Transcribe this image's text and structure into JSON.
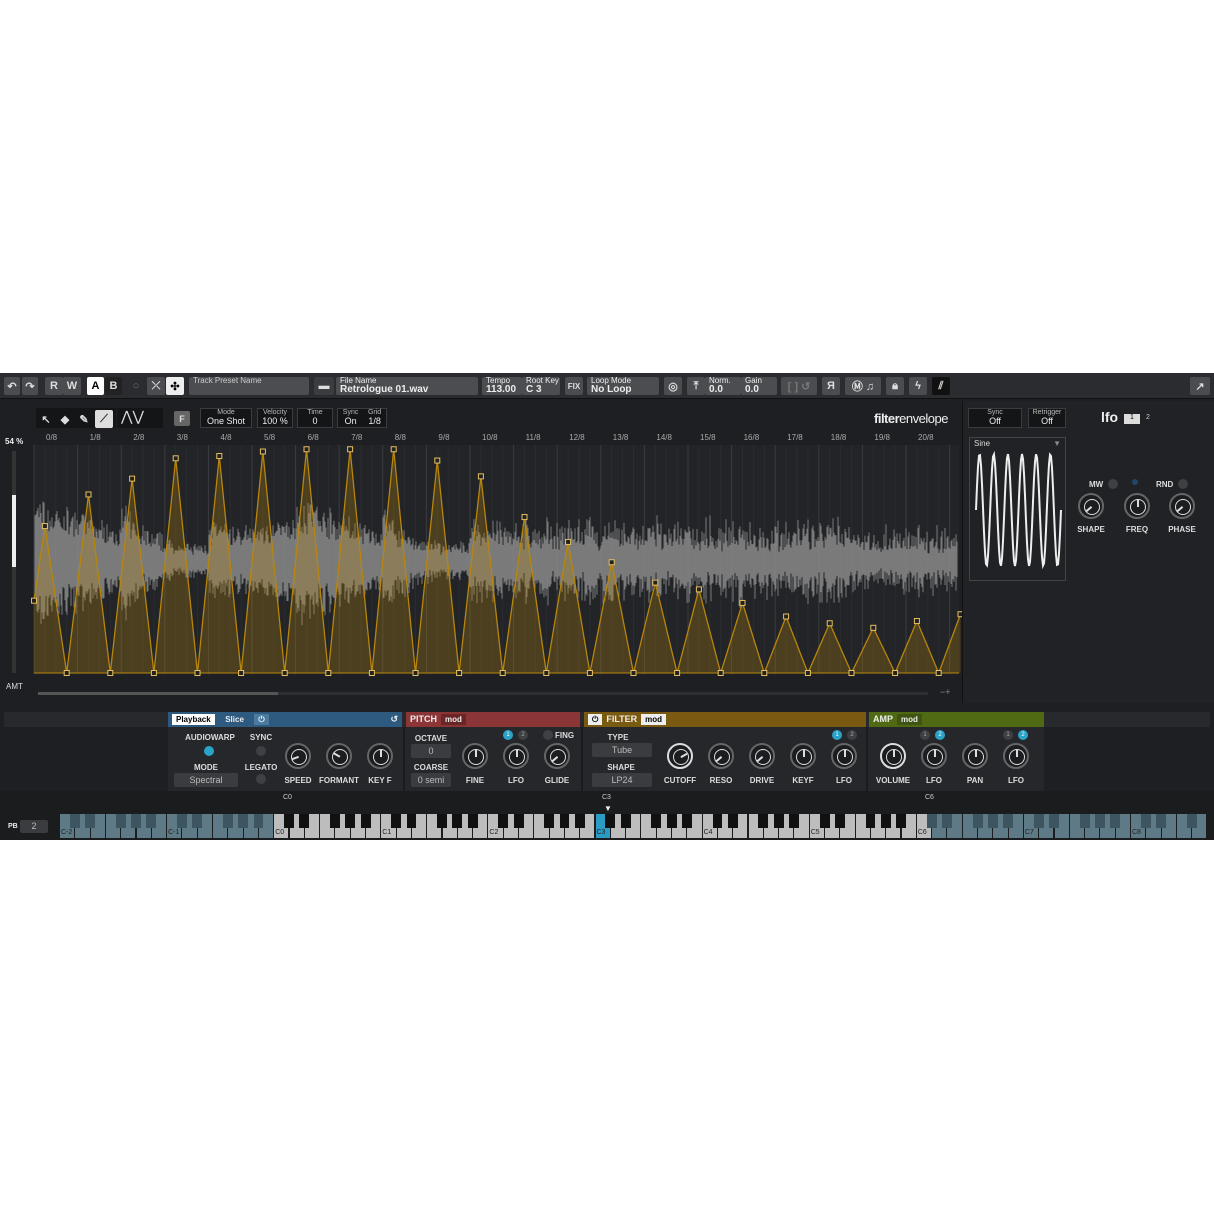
{
  "toolbar": {
    "r": "R",
    "w": "W",
    "a": "A",
    "b": "B",
    "track_preset_label": "Track Preset Name",
    "file_name_label": "File Name",
    "file_name": "Retrologue 01.wav",
    "tempo_label": "Tempo",
    "tempo": "113.00",
    "root_key_label": "Root Key",
    "root_key": "C 3",
    "fix": "FIX",
    "loop_mode_label": "Loop Mode",
    "loop_mode": "No Loop",
    "norm_label": "Norm.",
    "norm": "0.0",
    "gain_label": "Gain",
    "gain": "0.0",
    "reverse": "Я"
  },
  "editor": {
    "mode_label": "Mode",
    "mode": "One Shot",
    "velocity_label": "Velocity",
    "velocity": "100 %",
    "time_label": "Time",
    "time": "0",
    "sync_label": "Sync",
    "sync": "On",
    "grid_label": "Grid",
    "grid": "1/8",
    "f_button": "F",
    "title_bold": "filter",
    "title_light": "envelope",
    "amount": "54 %",
    "amt_label": "AMT",
    "zoom_ctrl": "−+",
    "time_labels": [
      "0/8",
      "1/8",
      "2/8",
      "3/8",
      "4/8",
      "5/8",
      "6/8",
      "7/8",
      "8/8",
      "9/8",
      "10/8",
      "11/8",
      "12/8",
      "13/8",
      "14/8",
      "15/8",
      "16/8",
      "17/8",
      "18/8",
      "19/8",
      "20/8"
    ],
    "envelope_start_level": 0.32,
    "envelope_peaks": [
      0.65,
      0.79,
      0.86,
      0.95,
      0.96,
      0.98,
      0.99,
      0.99,
      0.99,
      0.94,
      0.87,
      0.69,
      0.58,
      0.49,
      0.4,
      0.37,
      0.31,
      0.25,
      0.22,
      0.2,
      0.23,
      0.26
    ],
    "amount_fraction": 0.54,
    "color_envelope": "#b8860b"
  },
  "lfo": {
    "sync_label": "Sync",
    "sync": "Off",
    "retrigger_label": "Retrigger",
    "retrigger": "Off",
    "title": "lfo",
    "tab1": "1",
    "tab2": "2",
    "waveform": "Sine",
    "mw": "MW",
    "rnd": "RND",
    "shape": "SHAPE",
    "freq": "FREQ",
    "phase": "PHASE"
  },
  "playback": {
    "tab_playback": "Playback",
    "tab_slice": "Slice",
    "audiowarp": "AUDIOWARP",
    "sync": "SYNC",
    "mode": "MODE",
    "mode_value": "Spectral",
    "legato": "LEGATO",
    "speed": "SPEED",
    "formant": "FORMANT",
    "keyf": "KEY F",
    "color": "#2f5a80"
  },
  "pitch": {
    "title": "PITCH",
    "mod": "mod",
    "octave": "OCTAVE",
    "octave_value": "0",
    "coarse": "COARSE",
    "coarse_value": "0 semi",
    "fing": "FING",
    "fine": "FINE",
    "lfo": "LFO",
    "glide": "GLIDE",
    "lfo1": "1",
    "lfo2": "2",
    "color": "#8c3536"
  },
  "filter": {
    "title": "FILTER",
    "mod": "mod",
    "type": "TYPE",
    "type_value": "Tube",
    "shape": "SHAPE",
    "shape_value": "LP24",
    "cutoff": "CUTOFF",
    "reso": "RESO",
    "drive": "DRIVE",
    "keyf": "KEYF",
    "lfo": "LFO",
    "lfo1": "1",
    "lfo2": "2",
    "color": "#7a5a10"
  },
  "amp": {
    "title": "AMP",
    "mod": "mod",
    "volume": "VOLUME",
    "lfo": "LFO",
    "pan": "PAN",
    "lfo_b": "LFO",
    "l1": "1",
    "l2": "2",
    "color": "#4f6a12"
  },
  "keyboard": {
    "pb_label": "PB",
    "pb_value": "2",
    "range_low": "C0",
    "range_mid": "C3",
    "range_high": "C6",
    "octave_labels": [
      "C-2",
      "C-1",
      "C0",
      "C1",
      "C2",
      "C3",
      "C4",
      "C5",
      "C6",
      "C7",
      "C8"
    ]
  }
}
